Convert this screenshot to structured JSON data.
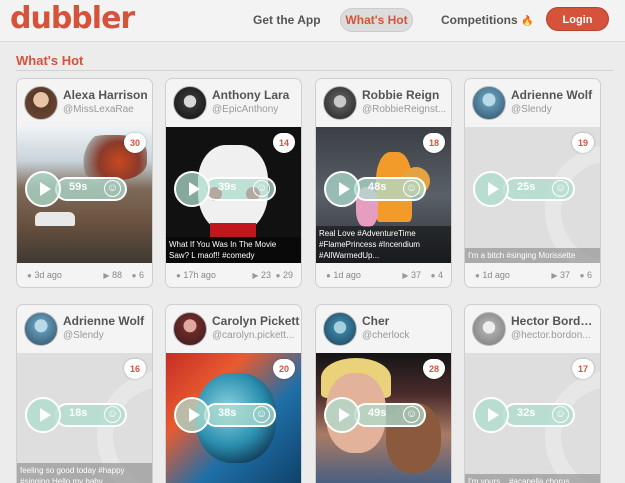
{
  "brand": {
    "logo": "dubbler",
    "accent": "#d4533a"
  },
  "nav": {
    "get_app": "Get the App",
    "whats_hot": "What's Hot",
    "competitions": "Competitions",
    "competitions_icon": "flame-icon",
    "login": "Login"
  },
  "section": {
    "title": "What's Hot"
  },
  "cards": [
    {
      "name": "Alexa Harrison",
      "handle": "@MissLexaRae",
      "likes": "30",
      "duration": "59s",
      "caption": "",
      "time": "3d ago",
      "plays": "88",
      "comments": "6"
    },
    {
      "name": "Anthony Lara",
      "handle": "@EpicAnthony",
      "likes": "14",
      "duration": "39s",
      "caption": "What If You Was In The Movie Saw? L maof!! #comedy",
      "time": "17h ago",
      "plays": "23",
      "comments": "29"
    },
    {
      "name": "Robbie Reign",
      "handle": "@RobbieReignst...",
      "likes": "18",
      "duration": "48s",
      "caption": "Real Love #AdventureTime #FlamePrincess #Incendium #AllWarmedUp...",
      "time": "1d ago",
      "plays": "37",
      "comments": "4"
    },
    {
      "name": "Adrienne Wolf",
      "handle": "@Slendy",
      "likes": "19",
      "duration": "25s",
      "caption": "I'm a bitch #singing Morissette",
      "time": "1d ago",
      "plays": "37",
      "comments": "6"
    },
    {
      "name": "Adrienne Wolf",
      "handle": "@Slendy",
      "likes": "16",
      "duration": "18s",
      "caption": "feeling so good today #happy #singing Hello my baby"
    },
    {
      "name": "Carolyn Pickett",
      "handle": "@carolyn.pickett...",
      "likes": "20",
      "duration": "38s",
      "caption": ""
    },
    {
      "name": "Cher",
      "handle": "@cherlock",
      "likes": "28",
      "duration": "49s",
      "caption": ""
    },
    {
      "name": "Hector Bordon...",
      "handle": "@hector.bordon...",
      "likes": "17",
      "duration": "32s",
      "caption": "I'm yours... #acapella chorus"
    }
  ]
}
